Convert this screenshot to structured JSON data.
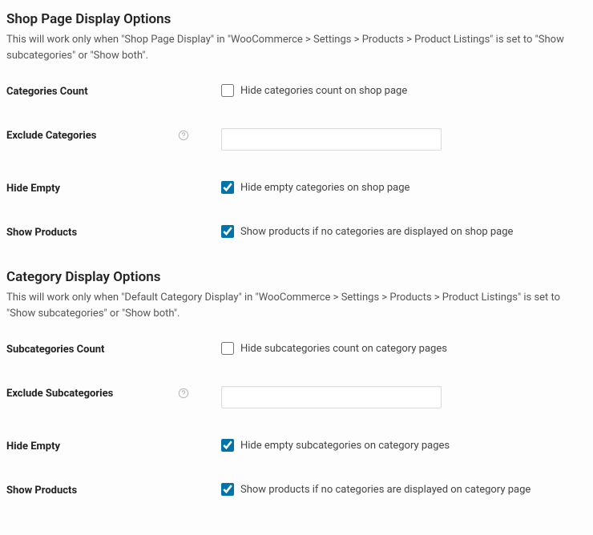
{
  "section1": {
    "heading": "Shop Page Display Options",
    "description": "This will work only when \"Shop Page Display\" in \"WooCommerce > Settings > Products > Product Listings\" is set to \"Show subcategories\" or \"Show both\".",
    "rows": {
      "categoriesCount": {
        "label": "Categories Count",
        "checkboxLabel": "Hide categories count on shop page",
        "checked": false
      },
      "excludeCategories": {
        "label": "Exclude Categories",
        "value": ""
      },
      "hideEmpty": {
        "label": "Hide Empty",
        "checkboxLabel": "Hide empty categories on shop page",
        "checked": true
      },
      "showProducts": {
        "label": "Show Products",
        "checkboxLabel": "Show products if no categories are displayed on shop page",
        "checked": true
      }
    }
  },
  "section2": {
    "heading": "Category Display Options",
    "description": "This will work only when \"Default Category Display\" in \"WooCommerce > Settings > Products > Product Listings\" is set to \"Show subcategories\" or \"Show both\".",
    "rows": {
      "subcategoriesCount": {
        "label": "Subcategories Count",
        "checkboxLabel": "Hide subcategories count on category pages",
        "checked": false
      },
      "excludeSubcategories": {
        "label": "Exclude Subcategories",
        "value": ""
      },
      "hideEmpty": {
        "label": "Hide Empty",
        "checkboxLabel": "Hide empty subcategories on category pages",
        "checked": true
      },
      "showProducts": {
        "label": "Show Products",
        "checkboxLabel": "Show products if no categories are displayed on category page",
        "checked": true
      }
    }
  }
}
